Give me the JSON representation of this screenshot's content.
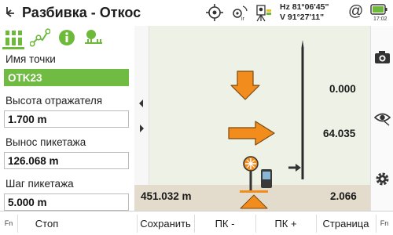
{
  "header": {
    "title": "Разбивка - Откос",
    "hz": "Hz 81°06'45\"",
    "v": "V 91°27'11\"",
    "at": "@",
    "time": "17:02"
  },
  "left_panel": {
    "tabs": [
      "survey-icon",
      "polyline-icon",
      "info-icon",
      "tree-icon"
    ],
    "fields": [
      {
        "label": "Имя точки",
        "value": "OTK23"
      },
      {
        "label": "Высота отражателя",
        "value": "1.700 m"
      },
      {
        "label": "Вынос пикетажа",
        "value": "126.068 m"
      },
      {
        "label": "Шаг пикетажа",
        "value": "5.000 m"
      }
    ]
  },
  "scene": {
    "height_diff": "0.000",
    "offset": "64.035",
    "bottom_value": "2.066",
    "ground_distance": "451.032 m",
    "colors": {
      "arrow": "#f28c1c",
      "sky": "#edf1e6",
      "ground": "#e3dccd"
    }
  },
  "right_bar": {
    "icons": [
      "camera-icon",
      "eye-icon",
      "settings-icon"
    ]
  },
  "bottom_bar": {
    "fn_left": "Fn",
    "stop": "Стоп",
    "save": "Сохранить",
    "pk_minus": "ПК -",
    "pk_plus": "ПК +",
    "page": "Страница",
    "fn_right": "Fn"
  },
  "accent": "#70bb42"
}
